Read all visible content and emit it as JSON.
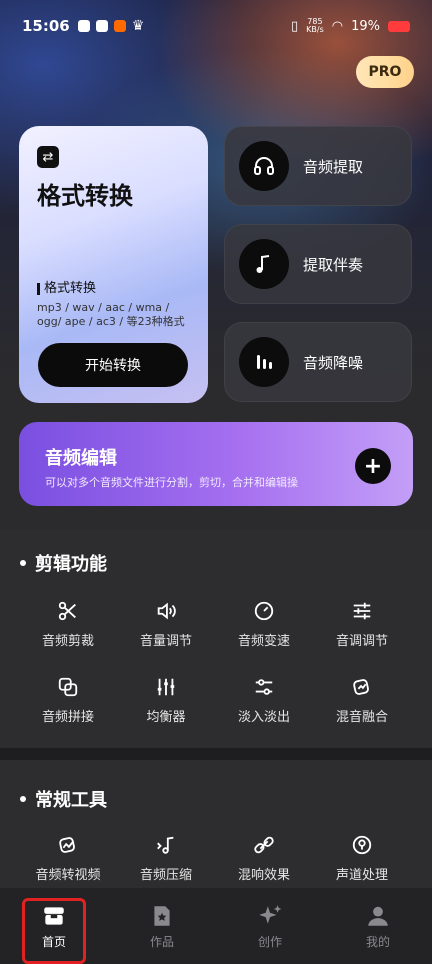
{
  "status": {
    "time": "15:06",
    "speed_top": "785",
    "speed_bottom": "KB/s",
    "battery": "19%"
  },
  "pro_label": "PRO",
  "main_card": {
    "title": "格式转换",
    "subtitle": "格式转换",
    "description": "mp3 / wav / aac / wma / ogg/ ape / ac3 / 等23种格式",
    "button": "开始转换",
    "icon": "swap-icon"
  },
  "side_cards": [
    {
      "label": "音频提取",
      "icon": "headphones-icon"
    },
    {
      "label": "提取伴奏",
      "icon": "music-note-icon"
    },
    {
      "label": "音频降噪",
      "icon": "waveform-icon"
    }
  ],
  "edit_bar": {
    "title": "音频编辑",
    "subtitle": "可以对多个音频文件进行分割，剪切，合并和编辑操",
    "plus": "+"
  },
  "section1": {
    "title": "剪辑功能",
    "tools": [
      {
        "label": "音频剪裁",
        "icon": "scissors-icon"
      },
      {
        "label": "音量调节",
        "icon": "volume-icon"
      },
      {
        "label": "音频变速",
        "icon": "speed-icon"
      },
      {
        "label": "音调调节",
        "icon": "tune-icon"
      },
      {
        "label": "音频拼接",
        "icon": "merge-icon"
      },
      {
        "label": "均衡器",
        "icon": "equalizer-icon"
      },
      {
        "label": "淡入淡出",
        "icon": "fade-icon"
      },
      {
        "label": "混音融合",
        "icon": "mix-icon"
      }
    ]
  },
  "section2": {
    "title": "常规工具",
    "tools": [
      {
        "label": "音频转视频",
        "icon": "audio-video-icon"
      },
      {
        "label": "音频压缩",
        "icon": "compress-icon"
      },
      {
        "label": "混响效果",
        "icon": "reverb-icon"
      },
      {
        "label": "声道处理",
        "icon": "channel-icon"
      }
    ]
  },
  "tabs": [
    {
      "label": "首页",
      "icon": "home-icon",
      "active": true
    },
    {
      "label": "作品",
      "icon": "works-icon",
      "active": false
    },
    {
      "label": "创作",
      "icon": "create-icon",
      "active": false
    },
    {
      "label": "我的",
      "icon": "profile-icon",
      "active": false
    }
  ]
}
